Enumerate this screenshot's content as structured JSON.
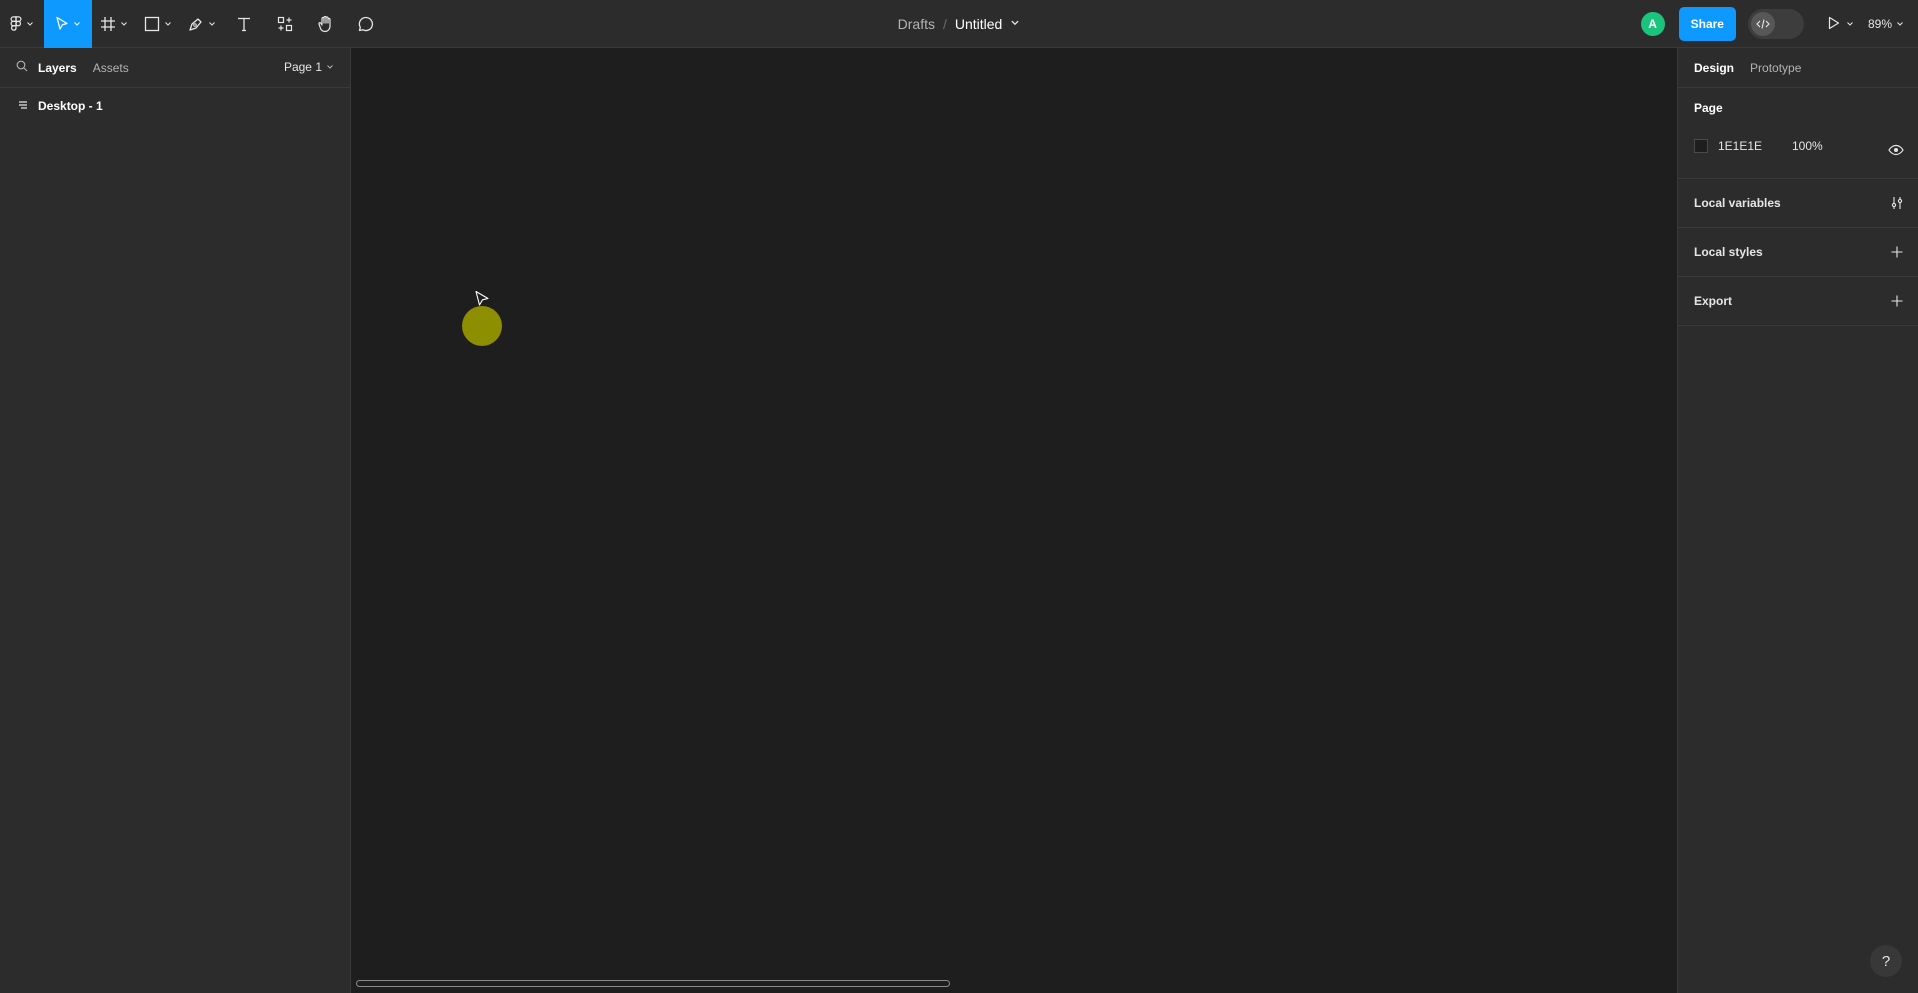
{
  "toolbar": {
    "tools": [
      {
        "name": "main-menu",
        "icon": "figma-logo-icon"
      },
      {
        "name": "move-tool",
        "icon": "pointer-icon",
        "active": true
      },
      {
        "name": "frame-tool",
        "icon": "frame-icon"
      },
      {
        "name": "shape-tool",
        "icon": "rectangle-icon"
      },
      {
        "name": "pen-tool",
        "icon": "pen-icon"
      },
      {
        "name": "text-tool",
        "icon": "text-icon"
      },
      {
        "name": "resources-tool",
        "icon": "resources-icon"
      },
      {
        "name": "hand-tool",
        "icon": "hand-icon"
      },
      {
        "name": "comment-tool",
        "icon": "comment-icon"
      }
    ],
    "breadcrumb": {
      "folder": "Drafts",
      "separator": "/",
      "file": "Untitled"
    },
    "avatar_initial": "A",
    "share_label": "Share",
    "zoom_label": "89%"
  },
  "left_panel": {
    "tabs": {
      "layers": "Layers",
      "assets": "Assets"
    },
    "page_selector": "Page 1",
    "layers": [
      {
        "name": "Desktop - 1"
      }
    ]
  },
  "right_panel": {
    "tabs": {
      "design": "Design",
      "prototype": "Prototype"
    },
    "page_section": {
      "title": "Page",
      "fill_hex": "1E1E1E",
      "fill_opacity": "100%"
    },
    "sections": {
      "local_variables": "Local variables",
      "local_styles": "Local styles",
      "export": "Export"
    }
  },
  "help_label": "?",
  "colors": {
    "accent": "#0d99ff",
    "avatar": "#1bc47d",
    "ellipse_fill": "#8e8f00",
    "canvas": "#1e1e1e",
    "panel": "#2c2c2c"
  }
}
